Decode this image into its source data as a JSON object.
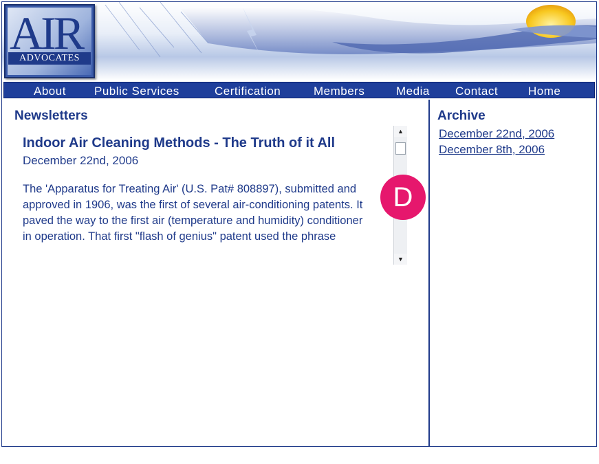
{
  "logo": {
    "main_text": "AIR",
    "sub_text": "ADVOCATES"
  },
  "nav": {
    "items": [
      {
        "label": "About"
      },
      {
        "label": "Public Services"
      },
      {
        "label": "Certification"
      },
      {
        "label": "Members"
      },
      {
        "label": "Media"
      },
      {
        "label": "Contact"
      },
      {
        "label": "Home"
      }
    ]
  },
  "main": {
    "section_title": "Newsletters",
    "article": {
      "title": "Indoor Air Cleaning Methods - The Truth of it All",
      "date": "December 22nd, 2006",
      "body": "The 'Apparatus for Treating Air' (U.S. Pat# 808897), submitted and approved in 1906, was the first of several air-conditioning patents. It paved the way to the first air (temperature and humidity) conditioner in operation. That first \"flash of genius\" patent used the phrase"
    },
    "scrollbar": {
      "up_icon": "▲",
      "down_icon": "▼"
    }
  },
  "badge": {
    "letter": "D",
    "color": "#e6176d"
  },
  "archive": {
    "title": "Archive",
    "links": [
      {
        "label": "December 22nd, 2006"
      },
      {
        "label": "December 8th, 2006"
      }
    ]
  },
  "colors": {
    "brand_blue": "#1f3a8a",
    "nav_blue": "#1f3f9b"
  }
}
